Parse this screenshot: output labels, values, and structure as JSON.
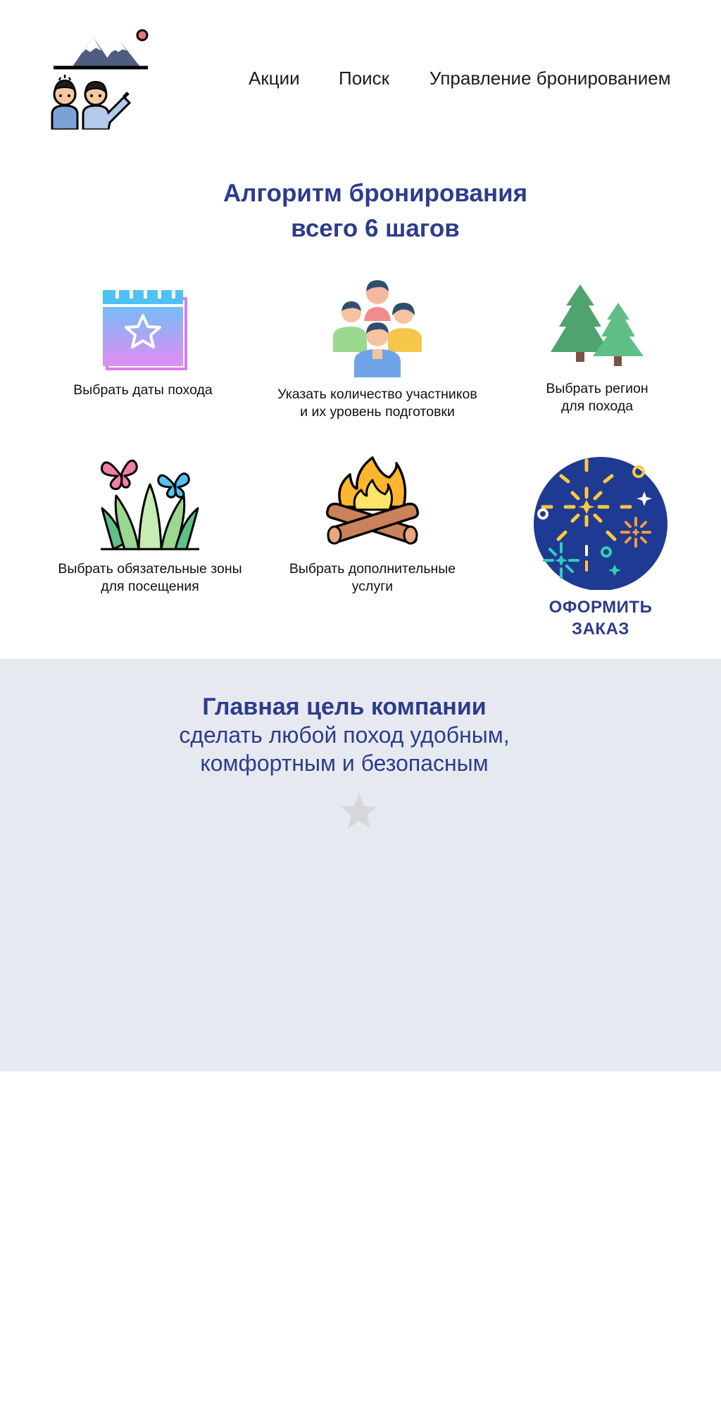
{
  "nav": {
    "items": [
      {
        "label": "Акции"
      },
      {
        "label": "Поиск"
      },
      {
        "label": "Управление бронированием"
      }
    ]
  },
  "booking": {
    "title_line1": "Алгоритм бронирования",
    "title_line2": "всего 6 шагов",
    "steps": [
      {
        "label": "Выбрать даты похода",
        "icon": "calendar-star-icon"
      },
      {
        "label": "Указать количество участников\nи их уровень подготовки",
        "icon": "group-of-people-icon"
      },
      {
        "label": "Выбрать регион\nдля похода",
        "icon": "pine-trees-icon"
      },
      {
        "label": "Выбрать обязательные зоны\nдля посещения",
        "icon": "grass-butterflies-icon"
      },
      {
        "label": "Выбрать дополнительные\nуслуги",
        "icon": "campfire-icon"
      }
    ],
    "cta_label": "ОФОРМИТЬ\nЗАКАЗ",
    "cta_icon": "fireworks-icon"
  },
  "mission": {
    "heading": "Главная цель компании",
    "body": "сделать  любой поход удобным,\nкомфортным и безопасным",
    "icon": "star-icon"
  },
  "colors": {
    "accent": "#2d3c8b",
    "mission_bg": "#e7e9f0",
    "cta_circle": "#1f3a93"
  }
}
